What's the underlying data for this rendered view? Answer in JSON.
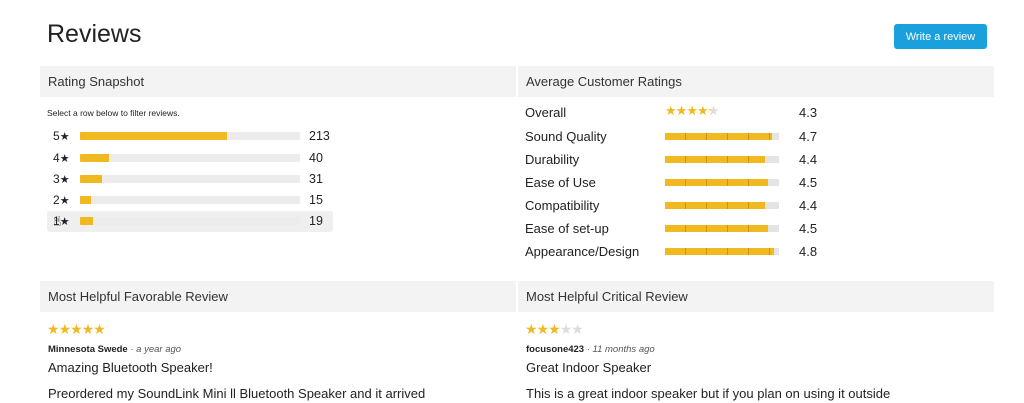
{
  "header": {
    "title": "Reviews",
    "write_review_label": "Write a review",
    "accent_color": "#1aa0dd"
  },
  "rating_snapshot": {
    "heading": "Rating Snapshot",
    "hint": "Select a row below to filter reviews.",
    "rows": [
      {
        "stars": "5",
        "count": "213",
        "fraction": 0.67
      },
      {
        "stars": "4",
        "count": "40",
        "fraction": 0.13
      },
      {
        "stars": "3",
        "count": "31",
        "fraction": 0.1
      },
      {
        "stars": "2",
        "count": "15",
        "fraction": 0.05
      },
      {
        "stars": "1",
        "count": "19",
        "fraction": 0.06
      }
    ],
    "bar_color": "#f0b920"
  },
  "average_ratings": {
    "heading": "Average Customer Ratings",
    "overall": {
      "label": "Overall",
      "value": "4.3",
      "stars": 4.3
    },
    "items": [
      {
        "label": "Sound Quality",
        "value": "4.7"
      },
      {
        "label": "Durability",
        "value": "4.4"
      },
      {
        "label": "Ease of Use",
        "value": "4.5"
      },
      {
        "label": "Compatibility",
        "value": "4.4"
      },
      {
        "label": "Ease of set-up",
        "value": "4.5"
      },
      {
        "label": "Appearance/Design",
        "value": "4.8"
      }
    ]
  },
  "favorable_review": {
    "heading": "Most Helpful Favorable Review",
    "stars": 5,
    "author": "Minnesota Swede",
    "time_ago": "· a year ago",
    "title": "Amazing Bluetooth Speaker!",
    "body": "Preordered my SoundLink Mini ll Bluetooth Speaker and it arrived"
  },
  "critical_review": {
    "heading": "Most Helpful Critical Review",
    "stars": 3,
    "author": "focusone423",
    "time_ago": "· 11 months ago",
    "title": "Great Indoor Speaker",
    "body": "This is a great indoor speaker but if you plan on using it outside"
  }
}
